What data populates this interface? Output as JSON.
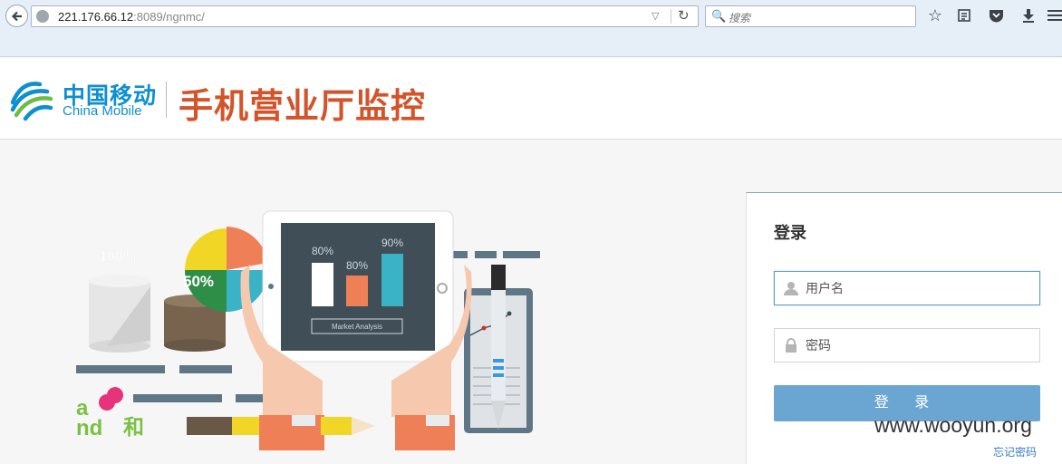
{
  "browser": {
    "url_host": "221.176.66.12",
    "url_rest": ":8089/ngnmc/",
    "search_placeholder": "搜索"
  },
  "header": {
    "logo_cn": "中国移动",
    "logo_en": "China Mobile",
    "title": "手机营业厅监控"
  },
  "illustration": {
    "pct_100": "100%",
    "pct_50": "50%",
    "bar1": "80%",
    "bar2": "80%",
    "bar3": "90%",
    "tablet_label": "Market Analysis",
    "brand_he": "和"
  },
  "login": {
    "title": "登录",
    "username_placeholder": "用户名",
    "password_placeholder": "密码",
    "submit": "登 录",
    "forgot": "忘记密码"
  },
  "watermark": "www.wooyun.org"
}
